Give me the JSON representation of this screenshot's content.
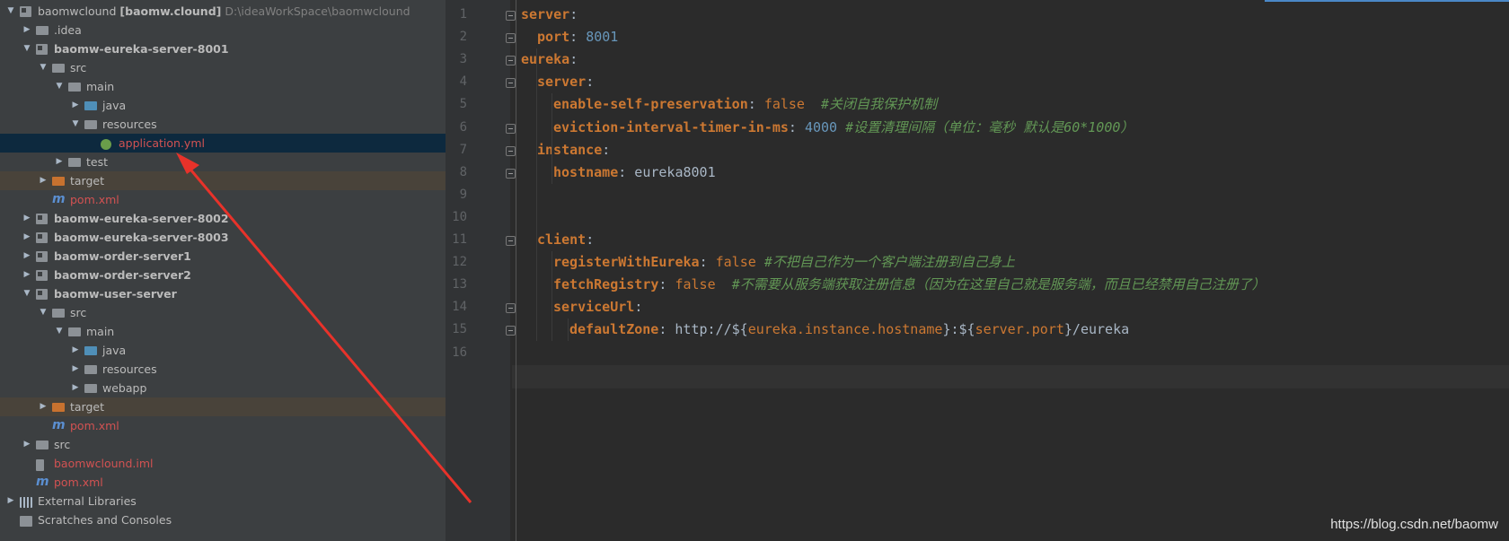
{
  "project_tree": [
    {
      "level": 0,
      "expanded": true,
      "icon": "module-icon",
      "name": "baomwclound",
      "bold_suffix": "[baomw.clound]",
      "path": "D:\\ideaWorkSpace\\baomwclound"
    },
    {
      "level": 1,
      "expanded": false,
      "icon": "folder-icon",
      "name": ".idea"
    },
    {
      "level": 1,
      "expanded": true,
      "icon": "module-icon",
      "name": "baomw-eureka-server-8001",
      "bold": true
    },
    {
      "level": 2,
      "expanded": true,
      "icon": "folder-icon",
      "name": "src"
    },
    {
      "level": 3,
      "expanded": true,
      "icon": "folder-icon",
      "name": "main"
    },
    {
      "level": 4,
      "expanded": false,
      "icon": "source-folder-icon",
      "name": "java"
    },
    {
      "level": 4,
      "expanded": true,
      "icon": "resources-folder-icon",
      "name": "resources"
    },
    {
      "level": 5,
      "leaf": true,
      "icon": "spring-yml-icon",
      "name": "application.yml",
      "red": true,
      "selected": true
    },
    {
      "level": 3,
      "expanded": false,
      "icon": "folder-icon",
      "name": "test"
    },
    {
      "level": 2,
      "expanded": false,
      "icon": "excluded-folder-icon",
      "name": "target",
      "excluded": true
    },
    {
      "level": 2,
      "leaf": true,
      "icon": "maven-icon",
      "name": "pom.xml",
      "red": true
    },
    {
      "level": 1,
      "expanded": false,
      "icon": "module-icon",
      "name": "baomw-eureka-server-8002",
      "bold": true
    },
    {
      "level": 1,
      "expanded": false,
      "icon": "module-icon",
      "name": "baomw-eureka-server-8003",
      "bold": true
    },
    {
      "level": 1,
      "expanded": false,
      "icon": "module-icon",
      "name": "baomw-order-server1",
      "bold": true
    },
    {
      "level": 1,
      "expanded": false,
      "icon": "module-icon",
      "name": "baomw-order-server2",
      "bold": true
    },
    {
      "level": 1,
      "expanded": true,
      "icon": "module-icon",
      "name": "baomw-user-server",
      "bold": true
    },
    {
      "level": 2,
      "expanded": true,
      "icon": "folder-icon",
      "name": "src"
    },
    {
      "level": 3,
      "expanded": true,
      "icon": "folder-icon",
      "name": "main"
    },
    {
      "level": 4,
      "expanded": false,
      "icon": "source-folder-icon",
      "name": "java"
    },
    {
      "level": 4,
      "expanded": false,
      "icon": "resources-folder-icon",
      "name": "resources"
    },
    {
      "level": 4,
      "expanded": false,
      "icon": "folder-icon",
      "name": "webapp"
    },
    {
      "level": 2,
      "expanded": false,
      "icon": "excluded-folder-icon",
      "name": "target",
      "excluded": true
    },
    {
      "level": 2,
      "leaf": true,
      "icon": "maven-icon",
      "name": "pom.xml",
      "red": true
    },
    {
      "level": 1,
      "expanded": false,
      "icon": "folder-icon",
      "name": "src"
    },
    {
      "level": 1,
      "leaf": true,
      "icon": "iml-file-icon",
      "name": "baomwclound.iml",
      "red": true
    },
    {
      "level": 1,
      "leaf": true,
      "icon": "maven-icon",
      "name": "pom.xml",
      "red": true
    },
    {
      "level": 0,
      "expanded": false,
      "icon": "libraries-icon",
      "name": "External Libraries"
    },
    {
      "level": 0,
      "leaf": true,
      "icon": "scratches-icon",
      "name": "Scratches and Consoles"
    }
  ],
  "editor": {
    "line_numbers": [
      "1",
      "2",
      "3",
      "4",
      "5",
      "6",
      "7",
      "8",
      "9",
      "10",
      "11",
      "12",
      "13",
      "14",
      "15",
      "16"
    ],
    "lines": [
      {
        "indent": 0,
        "parts": [
          [
            "k",
            "server"
          ],
          [
            "p",
            ":"
          ]
        ]
      },
      {
        "indent": 1,
        "parts": [
          [
            "k",
            "port"
          ],
          [
            "p",
            ": "
          ],
          [
            "n",
            "8001"
          ]
        ]
      },
      {
        "indent": 0,
        "parts": [
          [
            "k",
            "eureka"
          ],
          [
            "p",
            ":"
          ]
        ]
      },
      {
        "indent": 1,
        "parts": [
          [
            "k",
            "server"
          ],
          [
            "p",
            ":"
          ]
        ]
      },
      {
        "indent": 2,
        "parts": [
          [
            "k",
            "enable-self-preservation"
          ],
          [
            "p",
            ": "
          ],
          [
            "b",
            "false"
          ],
          [
            "p",
            "  "
          ],
          [
            "c",
            "#关闭自我保护机制"
          ]
        ]
      },
      {
        "indent": 2,
        "parts": [
          [
            "k",
            "eviction-interval-timer-in-ms"
          ],
          [
            "p",
            ": "
          ],
          [
            "n",
            "4000"
          ],
          [
            "p",
            " "
          ],
          [
            "c",
            "#设置清理间隔（单位：毫秒 默认是60*1000）"
          ]
        ]
      },
      {
        "indent": 1,
        "parts": [
          [
            "k",
            "instance"
          ],
          [
            "p",
            ":"
          ]
        ]
      },
      {
        "indent": 2,
        "parts": [
          [
            "k",
            "hostname"
          ],
          [
            "p",
            ": eureka8001"
          ]
        ]
      },
      {
        "indent": 0,
        "parts": []
      },
      {
        "indent": 0,
        "parts": []
      },
      {
        "indent": 1,
        "parts": [
          [
            "k",
            "client"
          ],
          [
            "p",
            ":"
          ]
        ]
      },
      {
        "indent": 2,
        "parts": [
          [
            "k",
            "registerWithEureka"
          ],
          [
            "p",
            ": "
          ],
          [
            "b",
            "false"
          ],
          [
            "p",
            " "
          ],
          [
            "c",
            "#不把自己作为一个客户端注册到自己身上"
          ]
        ]
      },
      {
        "indent": 2,
        "parts": [
          [
            "k",
            "fetchRegistry"
          ],
          [
            "p",
            ": "
          ],
          [
            "b",
            "false"
          ],
          [
            "p",
            "  "
          ],
          [
            "c",
            "#不需要从服务端获取注册信息（因为在这里自己就是服务端，而且已经禁用自己注册了）"
          ]
        ]
      },
      {
        "indent": 2,
        "parts": [
          [
            "k",
            "serviceUrl"
          ],
          [
            "p",
            ":"
          ]
        ]
      },
      {
        "indent": 3,
        "parts": [
          [
            "k",
            "defaultZone"
          ],
          [
            "p",
            ": http://${"
          ],
          [
            "b",
            "eureka.instance.hostname"
          ],
          [
            "p",
            "}:${"
          ],
          [
            "b",
            "server.port"
          ],
          [
            "p",
            "}/eureka"
          ]
        ]
      },
      {
        "indent": 0,
        "parts": []
      }
    ],
    "fold_markers": [
      1,
      2,
      3,
      4,
      6,
      7,
      8,
      11,
      14,
      15
    ]
  },
  "watermark": "https://blog.csdn.net/baomw",
  "colors": {
    "keyword": "#cc7832",
    "number": "#6897bb",
    "comment": "#629755",
    "text": "#a9b7c6",
    "selection": "#0d293e",
    "annotation_arrow": "#e8322a"
  }
}
